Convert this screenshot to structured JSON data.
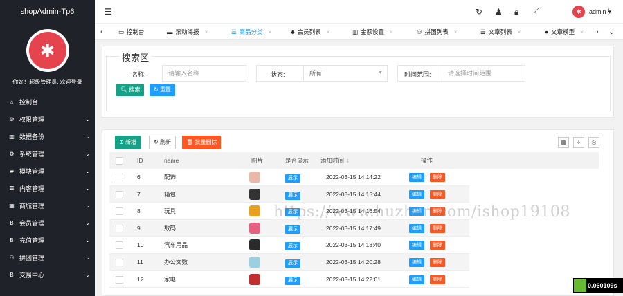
{
  "app": {
    "title": "shopAdmin-Tp6",
    "welcome": "你好！超级管理员, 欢迎登录"
  },
  "sidebar": {
    "items": [
      {
        "label": "控制台",
        "icon": "home-icon",
        "glyph": "⌂",
        "chevron": false
      },
      {
        "label": "权限管理",
        "icon": "gear-icon",
        "glyph": "⚙",
        "chevron": true
      },
      {
        "label": "数据备份",
        "icon": "bank-icon",
        "glyph": "▥",
        "chevron": true
      },
      {
        "label": "系统管理",
        "icon": "cogs-icon",
        "glyph": "⚙",
        "chevron": true
      },
      {
        "label": "模块管理",
        "icon": "module-icon",
        "glyph": "▰",
        "chevron": true
      },
      {
        "label": "内容管理",
        "icon": "list-icon",
        "glyph": "☰",
        "chevron": true
      },
      {
        "label": "商城管理",
        "icon": "calculator-icon",
        "glyph": "▦",
        "chevron": true
      },
      {
        "label": "会员管理",
        "icon": "member-icon",
        "glyph": "B",
        "chevron": true
      },
      {
        "label": "充值管理",
        "icon": "bitcoin-icon",
        "glyph": "B",
        "chevron": true
      },
      {
        "label": "拼团管理",
        "icon": "group-icon",
        "glyph": "⚇",
        "chevron": true
      },
      {
        "label": "交易中心",
        "icon": "bitcoin-icon",
        "glyph": "B",
        "chevron": true
      }
    ]
  },
  "header": {
    "user": "admin",
    "avatar_glyph": "✱"
  },
  "tabs": [
    {
      "label": "控制台",
      "icon": "monitor-icon",
      "glyph": "▭",
      "closable": false,
      "active": false
    },
    {
      "label": "滚动海报",
      "icon": "poster-icon",
      "glyph": "▬",
      "closable": true,
      "active": false
    },
    {
      "label": "商品分类",
      "icon": "list-icon",
      "glyph": "☰",
      "closable": true,
      "active": true
    },
    {
      "label": "会员列表",
      "icon": "user-icon",
      "glyph": "♣",
      "closable": true,
      "active": false
    },
    {
      "label": "金额设置",
      "icon": "bank-icon",
      "glyph": "▥",
      "closable": true,
      "active": false
    },
    {
      "label": "拼团列表",
      "icon": "group-icon",
      "glyph": "⚇",
      "closable": true,
      "active": false
    },
    {
      "label": "文章列表",
      "icon": "list-icon",
      "glyph": "☰",
      "closable": true,
      "active": false
    },
    {
      "label": "文章模型",
      "icon": "bomb-icon",
      "glyph": "●",
      "closable": true,
      "active": false
    }
  ],
  "search": {
    "legend": "搜索区",
    "name_label": "名称:",
    "name_placeholder": "请输入名称",
    "status_label": "状态:",
    "status_value": "所有",
    "time_label": "时间范围:",
    "time_placeholder": "请选择时间范围",
    "search_button": "搜索",
    "reset_button": "重置"
  },
  "toolbar": {
    "add": "新增",
    "refresh": "刷新",
    "batch_delete": "批量删除"
  },
  "table": {
    "headers": {
      "id": "ID",
      "name": "name",
      "image": "图片",
      "show": "是否显示",
      "time": "添加时间",
      "ops": "操作"
    },
    "show_label": "展示",
    "edit_label": "编辑",
    "delete_label": "删除",
    "rows": [
      {
        "id": "6",
        "name": "配饰",
        "time": "2022-03-15 14:14:22",
        "img_color": "#e8b8a8"
      },
      {
        "id": "7",
        "name": "箱包",
        "time": "2022-03-15 14:15:44",
        "img_color": "#333333"
      },
      {
        "id": "8",
        "name": "玩具",
        "time": "2022-03-15 14:16:54",
        "img_color": "#e8a020"
      },
      {
        "id": "9",
        "name": "数码",
        "time": "2022-03-15 14:17:49",
        "img_color": "#e56080"
      },
      {
        "id": "10",
        "name": "汽车用品",
        "time": "2022-03-15 14:18:40",
        "img_color": "#2a2a2a"
      },
      {
        "id": "11",
        "name": "办公文数",
        "time": "2022-03-15 14:20:28",
        "img_color": "#9ad0e0"
      },
      {
        "id": "12",
        "name": "家电",
        "time": "2022-03-15 14:22:01",
        "img_color": "#c03030"
      }
    ]
  },
  "watermark": "https://www.huzhan.com/ishop19108",
  "timer": "0.060109s",
  "colors": {
    "sidebar": "#20222a",
    "primary": "#1e9fff",
    "success": "#16b777",
    "danger": "#ff5722",
    "teal": "#16baaa"
  }
}
